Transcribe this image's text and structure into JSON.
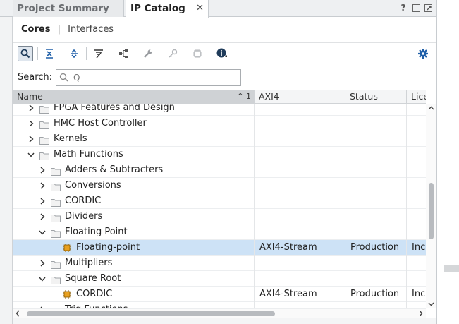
{
  "tabs": [
    {
      "label": "Project Summary"
    },
    {
      "label": "IP Catalog",
      "close": "✕"
    }
  ],
  "tab_actions": {
    "help": "?"
  },
  "subtabs": {
    "cores": "Cores",
    "separator": "|",
    "interfaces": "Interfaces"
  },
  "toolbar": {
    "icons": [
      "search-icon",
      "collapse-all-icon",
      "expand-all-icon",
      "filter-icon",
      "hierarchy-icon",
      "wrench-icon",
      "key-icon",
      "chip-icon",
      "info-icon",
      "settings-icon"
    ]
  },
  "search": {
    "label": "Search:",
    "placeholder": "Q-"
  },
  "table": {
    "columns": {
      "name": "Name",
      "axi": "AXI4",
      "status": "Status",
      "license": "Lice"
    },
    "sort_indicator": "^ 1",
    "rows": [
      {
        "name": "FPGA Features and Design",
        "level": 1,
        "type": "folder",
        "expand": ">",
        "axi": "",
        "status": "",
        "license": "",
        "partial": true
      },
      {
        "name": "HMC Host Controller",
        "level": 1,
        "type": "folder",
        "expand": ">",
        "axi": "",
        "status": "",
        "license": ""
      },
      {
        "name": "Kernels",
        "level": 1,
        "type": "folder",
        "expand": ">",
        "axi": "",
        "status": "",
        "license": ""
      },
      {
        "name": "Math Functions",
        "level": 1,
        "type": "folder",
        "expand": "v",
        "axi": "",
        "status": "",
        "license": ""
      },
      {
        "name": "Adders & Subtracters",
        "level": 2,
        "type": "folder",
        "expand": ">",
        "axi": "",
        "status": "",
        "license": ""
      },
      {
        "name": "Conversions",
        "level": 2,
        "type": "folder",
        "expand": ">",
        "axi": "",
        "status": "",
        "license": ""
      },
      {
        "name": "CORDIC",
        "level": 2,
        "type": "folder",
        "expand": ">",
        "axi": "",
        "status": "",
        "license": ""
      },
      {
        "name": "Dividers",
        "level": 2,
        "type": "folder",
        "expand": ">",
        "axi": "",
        "status": "",
        "license": ""
      },
      {
        "name": "Floating Point",
        "level": 2,
        "type": "folder",
        "expand": "v",
        "axi": "",
        "status": "",
        "license": ""
      },
      {
        "name": "Floating-point",
        "level": 3,
        "type": "core",
        "expand": "",
        "axi": "AXI4-Stream",
        "status": "Production",
        "license": "Inc",
        "selected": true
      },
      {
        "name": "Multipliers",
        "level": 2,
        "type": "folder",
        "expand": ">",
        "axi": "",
        "status": "",
        "license": ""
      },
      {
        "name": "Square Root",
        "level": 2,
        "type": "folder",
        "expand": "v",
        "axi": "",
        "status": "",
        "license": ""
      },
      {
        "name": "CORDIC",
        "level": 3,
        "type": "core",
        "expand": "",
        "axi": "AXI4-Stream",
        "status": "Production",
        "license": "Inc"
      },
      {
        "name": "Trig Functions",
        "level": 2,
        "type": "folder",
        "expand": ">",
        "axi": "",
        "status": "",
        "license": ""
      }
    ]
  },
  "colors": {
    "selection": "#cde2f6",
    "accent": "#1f5fa8",
    "core_icon": "#e8a020"
  }
}
